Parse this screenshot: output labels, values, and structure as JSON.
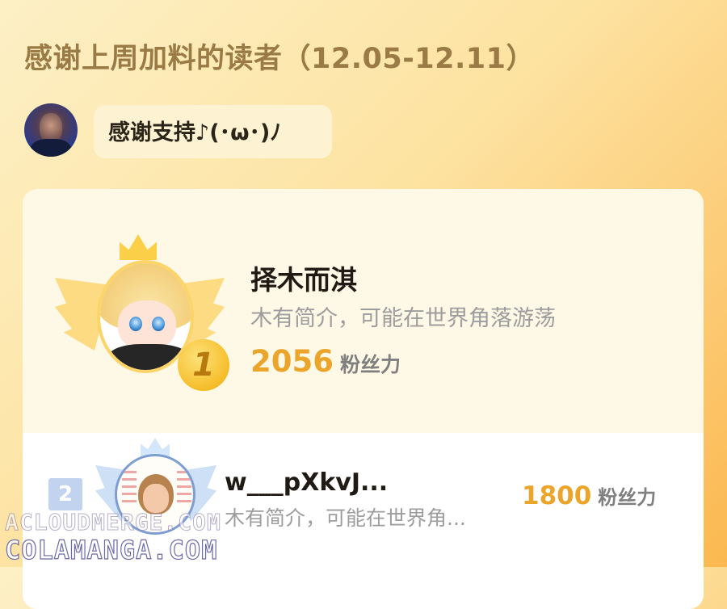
{
  "header": {
    "title": "感谢上周加料的读者（12.05-12.11）"
  },
  "message": {
    "avatar_icon": "user-avatar-icon",
    "text": "感谢支持♪(･ω･)ﾉ"
  },
  "leaderboard": {
    "first": {
      "rank": "1",
      "name": "择木而淇",
      "bio": "木有简介，可能在世界角落游荡",
      "fans_value": "2056",
      "fans_unit": "粉丝力",
      "accent_color": "#eba52a"
    },
    "second": {
      "rank": "2",
      "name": "w___pXkvJ...",
      "bio": "木有简介，可能在世界角...",
      "fans_value": "1800",
      "fans_unit": "粉丝力"
    }
  },
  "watermark": {
    "line1": "ACLOUDMERGE.COM",
    "line2": "COLAMANGA.COM"
  }
}
